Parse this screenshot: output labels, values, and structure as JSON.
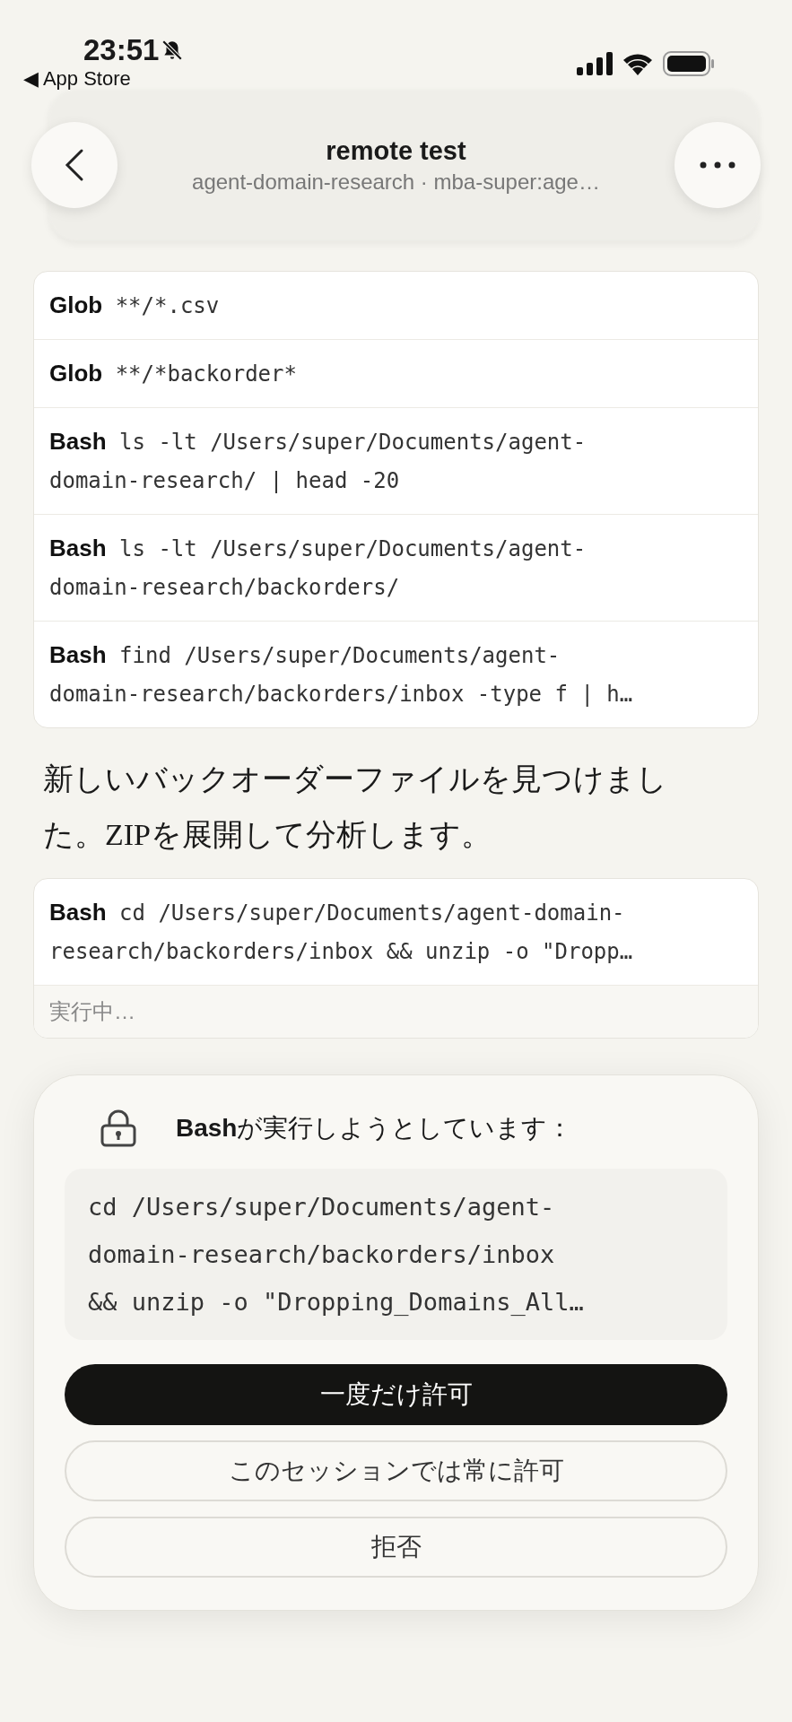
{
  "status_bar": {
    "time": "23:51",
    "silent": true,
    "back_app": "◀ App Store"
  },
  "header": {
    "title": "remote test",
    "subtitle": "agent-domain-research · mba-super:age…"
  },
  "tool_calls": [
    {
      "tool": "Glob",
      "command_lines": [
        "**/*.csv"
      ]
    },
    {
      "tool": "Glob",
      "command_lines": [
        "**/*backorder*"
      ]
    },
    {
      "tool": "Bash",
      "command_lines": [
        "ls -lt /Users/super/Documents/agent-",
        "domain-research/ | head -20"
      ]
    },
    {
      "tool": "Bash",
      "command_lines": [
        "ls -lt /Users/super/Documents/agent-",
        "domain-research/backorders/"
      ]
    },
    {
      "tool": "Bash",
      "command_lines": [
        "find /Users/super/Documents/agent-",
        "domain-research/backorders/inbox -type f | h…"
      ]
    }
  ],
  "message": "新しいバックオーダーファイルを見つけました。ZIPを展開して分析します。",
  "running_call": {
    "tool": "Bash",
    "command_lines": [
      "cd /Users/super/Documents/agent-domain-",
      "research/backorders/inbox && unzip -o \"Dropp…"
    ],
    "status": "実行中…"
  },
  "permission": {
    "tool": "Bash",
    "prompt": "が実行しようとしています：",
    "command_lines": [
      "cd /Users/super/Documents/agent-",
      "domain-research/backorders/inbox",
      "&& unzip -o \"Dropping_Domains_All…"
    ],
    "buttons": [
      {
        "label": "一度だけ許可",
        "kind": "primary"
      },
      {
        "label": "このセッションでは常に許可",
        "kind": "secondary"
      },
      {
        "label": "拒否",
        "kind": "secondary"
      }
    ]
  }
}
